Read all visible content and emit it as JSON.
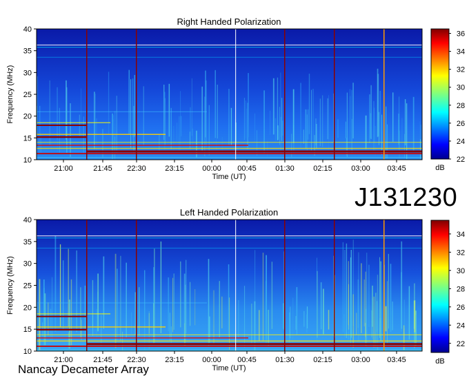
{
  "station": "Nancay Decameter Array",
  "source_id": "J131230",
  "chart_data": [
    {
      "type": "heatmap",
      "title": "Right Handed Polarization",
      "xlabel": "Time (UT)",
      "ylabel": "Frequency (MHz)",
      "ylim": [
        10,
        40
      ],
      "yticks": [
        "10",
        "15",
        "20",
        "25",
        "30",
        "35",
        "40"
      ],
      "xticks": [
        "21:00",
        "21:45",
        "22:30",
        "23:15",
        "00:00",
        "00:45",
        "01:30",
        "02:15",
        "03:00",
        "03:45"
      ],
      "colorbar": {
        "label": "dB",
        "range": [
          22,
          36.5
        ],
        "ticks": [
          "22",
          "24",
          "26",
          "28",
          "30",
          "32",
          "34",
          "36"
        ]
      },
      "colors": {
        "low": "#00008f",
        "mid": "#00c8ff",
        "high": "#8b0000"
      }
    },
    {
      "type": "heatmap",
      "title": "Left Handed Polarization",
      "xlabel": "Time (UT)",
      "ylabel": "Frequency (MHz)",
      "ylim": [
        10,
        40
      ],
      "yticks": [
        "10",
        "15",
        "20",
        "25",
        "30",
        "35",
        "40"
      ],
      "xticks": [
        "21:00",
        "21:45",
        "22:30",
        "23:15",
        "00:00",
        "00:45",
        "01:30",
        "02:15",
        "03:00",
        "03:45"
      ],
      "colorbar": {
        "label": "dB",
        "range": [
          21,
          35.5
        ],
        "ticks": [
          "22",
          "24",
          "26",
          "28",
          "30",
          "32",
          "34"
        ]
      },
      "colors": {
        "low": "#00008f",
        "mid": "#00c8ff",
        "high": "#8b0000"
      }
    }
  ]
}
